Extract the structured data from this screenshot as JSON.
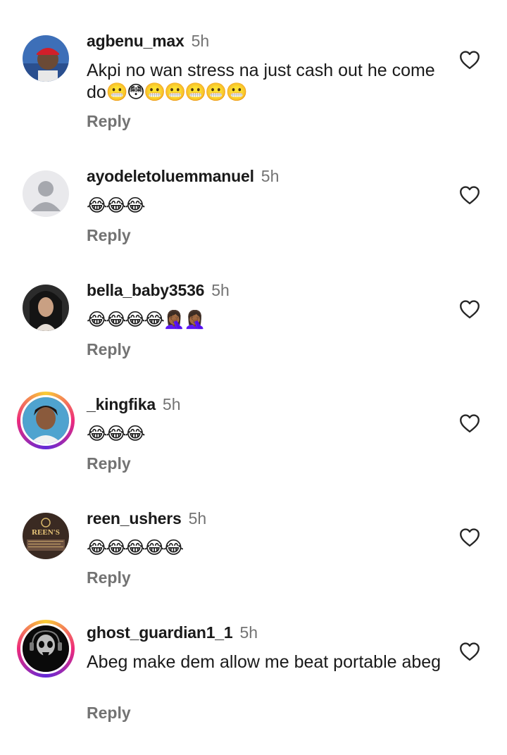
{
  "comments": [
    {
      "username": "agbenu_max",
      "time": "5h",
      "text": "Akpi no wan stress na just cash out he come do",
      "emoji": "😬😳😬😬😬😬😬",
      "reply": "Reply",
      "avatar": "photo-man-red-cap"
    },
    {
      "username": "ayodeletoluemmanuel",
      "time": "5h",
      "text": "",
      "emoji": "😂😂😂",
      "reply": "Reply",
      "avatar": "default-person"
    },
    {
      "username": "bella_baby3536",
      "time": "5h",
      "text": "",
      "emoji": "😂😂😂😂🤦🏾‍♀️🤦🏾‍♀️",
      "reply": "Reply",
      "avatar": "photo-woman"
    },
    {
      "username": "_kingfika",
      "time": "5h",
      "text": "",
      "emoji": "😂😂😂",
      "reply": "Reply",
      "avatar": "photo-woman-story-ring"
    },
    {
      "username": "reen_ushers",
      "time": "5h",
      "text": "",
      "emoji": "😂😂😂😂😂",
      "reply": "Reply",
      "avatar": "business-logo",
      "avatar_logo_text": "REEN'S"
    },
    {
      "username": "ghost_guardian1_1",
      "time": "5h",
      "text": "Abeg make dem allow me beat portable abeg",
      "emoji": "",
      "reply": "Reply",
      "avatar": "skull-logo-story-ring"
    }
  ],
  "icons": {
    "like": "heart-outline-icon"
  },
  "colors": {
    "text": "#1a1a1a",
    "secondary": "#737373",
    "story_ring_start": "#f9ce34",
    "story_ring_mid": "#ee2a7b",
    "story_ring_end": "#6228d7"
  }
}
